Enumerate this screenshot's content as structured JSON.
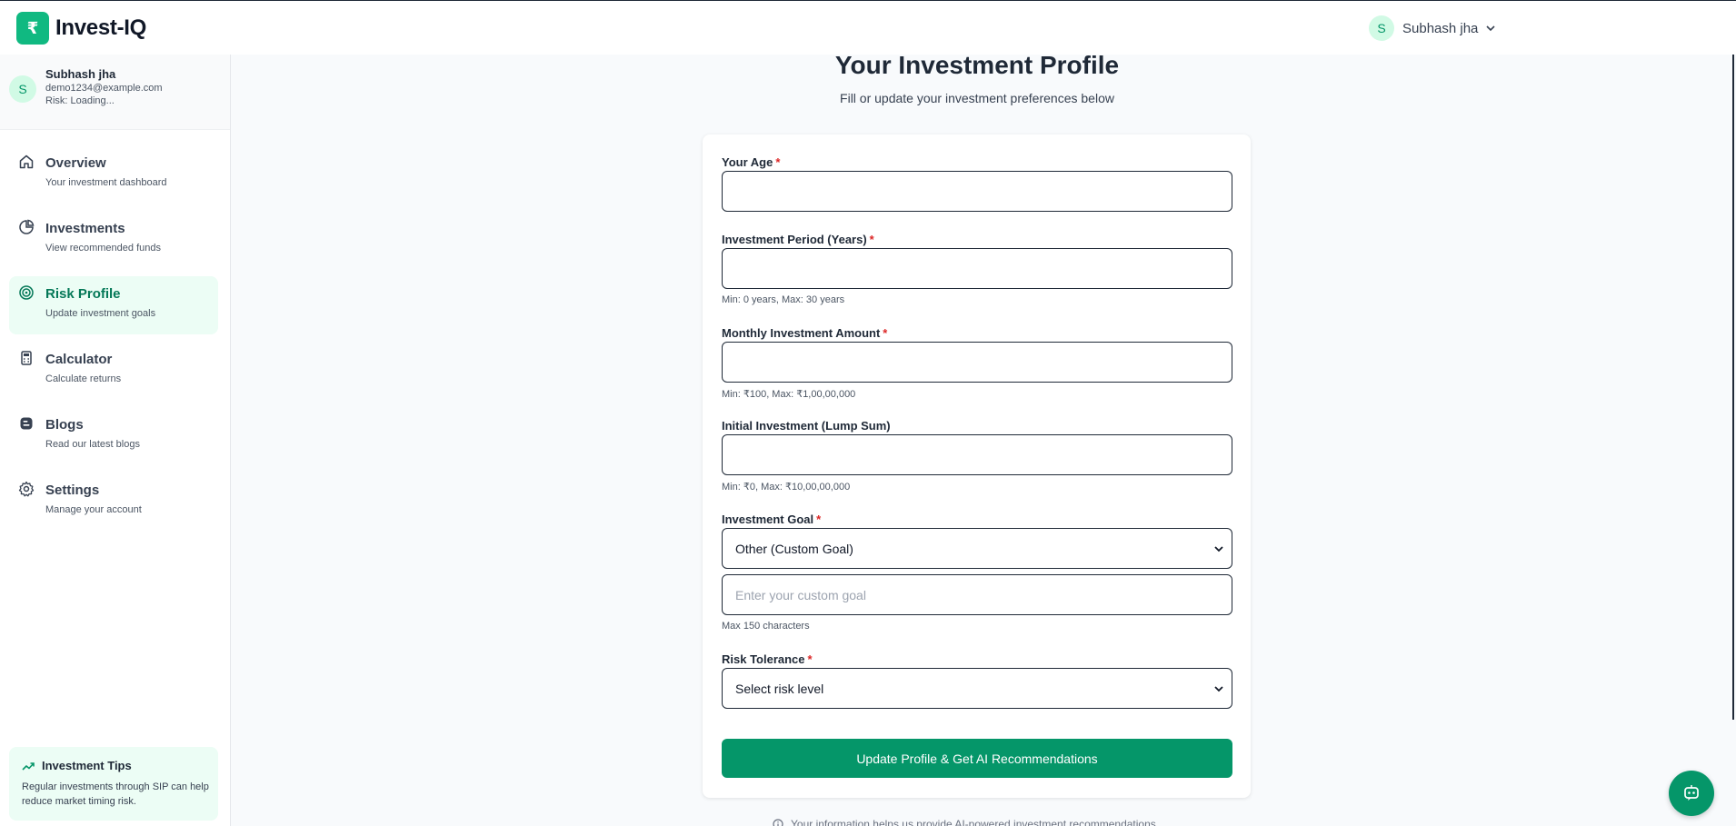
{
  "colors": {
    "accent": "#059669",
    "accent_light": "#ecfdf5",
    "required": "#dc2626"
  },
  "header": {
    "brand_name": "Invest-IQ",
    "brand_icon": "logo-icon",
    "user_initial": "S",
    "user_name": "Subhash jha",
    "menu_icon": "chevron-down-icon"
  },
  "sidebar": {
    "profile": {
      "initial": "S",
      "name": "Subhash jha",
      "email": "demo1234@example.com",
      "risk": "Risk: Loading..."
    },
    "items": [
      {
        "label": "Overview",
        "sub": "Your investment dashboard",
        "icon": "home-icon",
        "active": false
      },
      {
        "label": "Investments",
        "sub": "View recommended funds",
        "icon": "pie-chart-icon",
        "active": false
      },
      {
        "label": "Risk Profile",
        "sub": "Update investment goals",
        "icon": "target-icon",
        "active": true
      },
      {
        "label": "Calculator",
        "sub": "Calculate returns",
        "icon": "calculator-icon",
        "active": false
      },
      {
        "label": "Blogs",
        "sub": "Read our latest blogs",
        "icon": "blog-icon",
        "active": false
      },
      {
        "label": "Settings",
        "sub": "Manage your account",
        "icon": "gear-icon",
        "active": false
      }
    ],
    "tips": {
      "title": "Investment Tips",
      "text": "Regular investments through SIP can help reduce market timing risk.",
      "icon": "trending-up-icon"
    }
  },
  "main": {
    "title": "Your Investment Profile",
    "subtitle": "Fill or update your investment preferences below",
    "form": {
      "age": {
        "label": "Your Age",
        "required": "*",
        "value": ""
      },
      "period": {
        "label": "Investment Period (Years)",
        "required": "*",
        "value": "",
        "hint": "Min: 0 years, Max: 30 years"
      },
      "monthly": {
        "label": "Monthly Investment Amount",
        "required": "*",
        "value": "",
        "hint": "Min: ₹100, Max: ₹1,00,00,000"
      },
      "lumpsum": {
        "label": "Initial Investment (Lump Sum)",
        "value": "",
        "hint": "Min: ₹0, Max: ₹10,00,00,000"
      },
      "goal": {
        "label": "Investment Goal",
        "required": "*",
        "selected": "Other (Custom Goal)"
      },
      "custom_goal": {
        "placeholder": "Enter your custom goal",
        "value": "",
        "hint": "Max 150 characters"
      },
      "risk": {
        "label": "Risk Tolerance",
        "required": "*",
        "selected": "Select risk level"
      },
      "submit_label": "Update Profile & Get AI Recommendations"
    },
    "footnote": "Your information helps us provide AI-powered investment recommendations",
    "footnote_icon": "info-icon"
  },
  "chat": {
    "icon": "chatbot-icon"
  }
}
